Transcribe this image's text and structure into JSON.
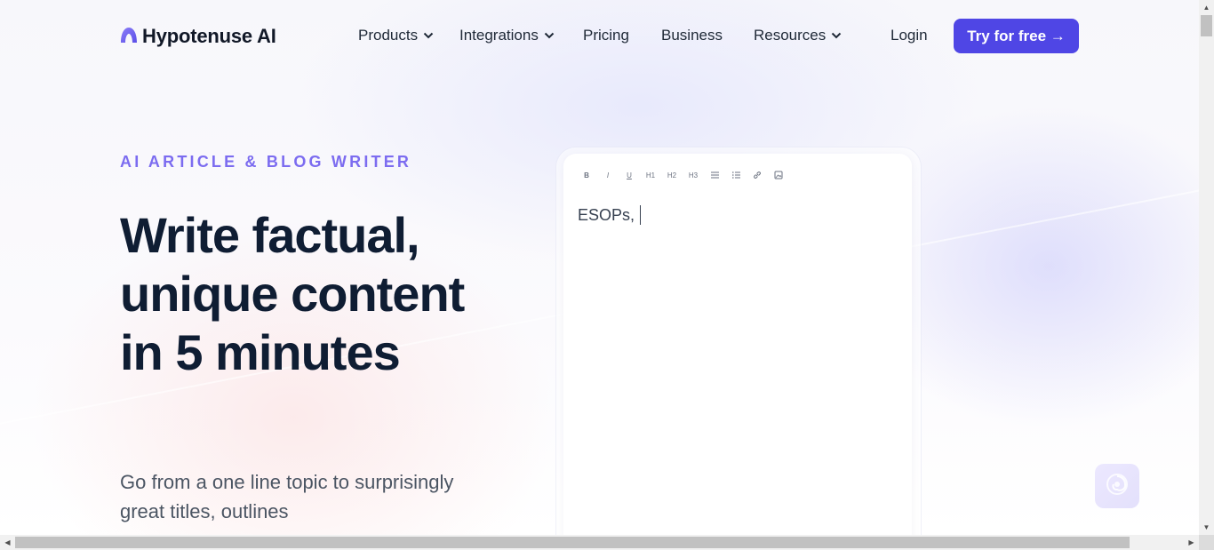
{
  "brand": {
    "name": "Hypotenuse AI",
    "accent": "#4f46e5",
    "logo_color": "#6d5ef2"
  },
  "nav": {
    "items": [
      {
        "label": "Products",
        "has_dropdown": true
      },
      {
        "label": "Integrations",
        "has_dropdown": true
      },
      {
        "label": "Pricing",
        "has_dropdown": false
      },
      {
        "label": "Business",
        "has_dropdown": false
      },
      {
        "label": "Resources",
        "has_dropdown": true
      }
    ],
    "login": "Login",
    "cta": "Try for free →"
  },
  "hero": {
    "eyebrow": "AI ARTICLE & BLOG WRITER",
    "headline": "Write factual, unique content in 5 minutes",
    "subtitle": "Go from a one line topic to surprisingly great titles, outlines"
  },
  "editor": {
    "toolbar": [
      {
        "label": "B",
        "icon": "bold-icon"
      },
      {
        "label": "I",
        "icon": "italic-icon"
      },
      {
        "label": "U",
        "icon": "underline-icon"
      },
      {
        "label": "H1",
        "icon": "heading1-icon"
      },
      {
        "label": "H2",
        "icon": "heading2-icon"
      },
      {
        "label": "H3",
        "icon": "heading3-icon"
      },
      {
        "label": "",
        "icon": "bullet-list-icon"
      },
      {
        "label": "",
        "icon": "numbered-list-icon"
      },
      {
        "label": "",
        "icon": "link-icon"
      },
      {
        "label": "",
        "icon": "image-icon"
      }
    ],
    "content": "ESOPs,"
  },
  "widget": {
    "icon": "swirl-icon"
  },
  "colors": {
    "headline": "#0f1d33",
    "eyebrow": "#7c6cf0",
    "subtitle": "#4b5563"
  }
}
